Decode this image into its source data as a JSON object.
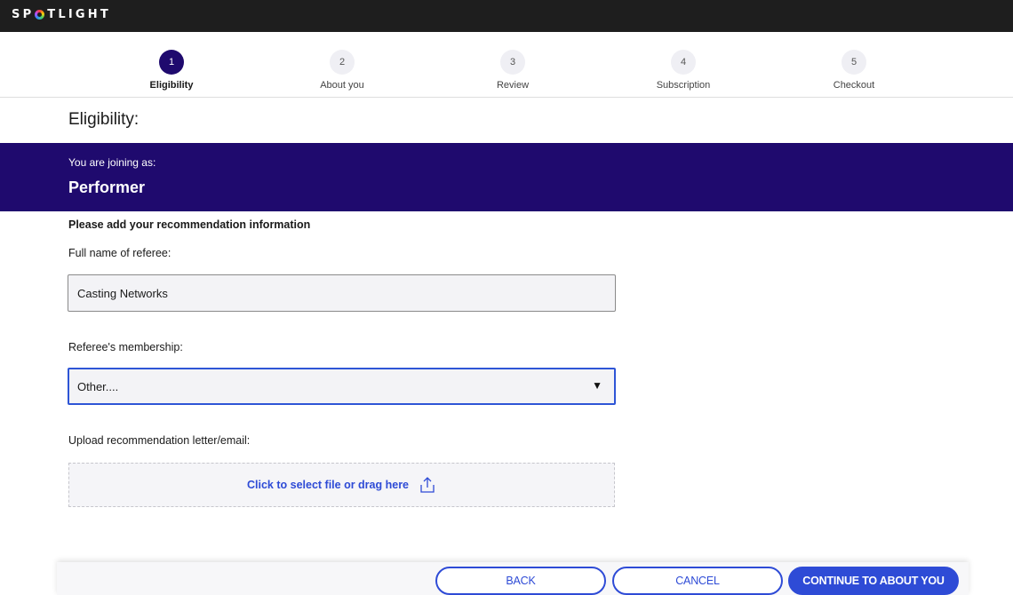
{
  "header": {
    "logo_text_prefix": "SP",
    "logo_text_suffix": "TLIGHT"
  },
  "stepper": {
    "steps": [
      {
        "number": "1",
        "label": "Eligibility",
        "active": true
      },
      {
        "number": "2",
        "label": "About you",
        "active": false
      },
      {
        "number": "3",
        "label": "Review",
        "active": false
      },
      {
        "number": "4",
        "label": "Subscription",
        "active": false
      },
      {
        "number": "5",
        "label": "Checkout",
        "active": false
      }
    ]
  },
  "page": {
    "heading": "Eligibility:"
  },
  "banner": {
    "joining_label": "You are joining as:",
    "role": "Performer",
    "color": "#1f0a6e"
  },
  "form": {
    "section_title": "Please add your recommendation information",
    "referee_name_label": "Full name of referee:",
    "referee_name_value": "Casting Networks",
    "membership_label": "Referee's membership:",
    "membership_value": "Other....",
    "upload_label": "Upload recommendation letter/email:",
    "upload_text": "Click to select file or drag here",
    "upload_icon": "upload-icon"
  },
  "footer": {
    "back_label": "BACK",
    "cancel_label": "CANCEL",
    "continue_label": "CONTINUE TO ABOUT YOU",
    "accent_color": "#2e4bd6"
  }
}
